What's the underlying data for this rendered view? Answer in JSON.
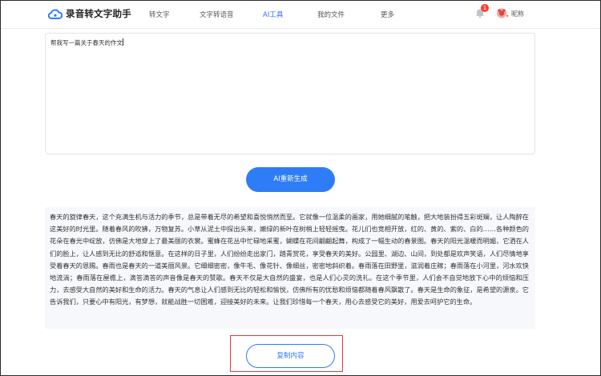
{
  "header": {
    "app_name": "录音转文字助手",
    "nav": [
      "转文字",
      "文字转语音",
      "AI工具",
      "我的文件",
      "更多"
    ],
    "active_nav": "AI工具",
    "notification_count": "1",
    "username": "昵称"
  },
  "prompt": {
    "text": "帮我写一篇关于春天的作文"
  },
  "regenerate_label": "AI重新生成",
  "result": {
    "text": "春天的旋律春天，这个充满生机与活力的季节，总是带着无尽的希望和喜悦悄然而至。它就像一位温柔的画家，用她细腻的笔触，把大地装扮得五彩斑斓，让人陶醉在这美好的时光里。随着春风的吹拂，万物复苏。小草从泥土中探出头来，嫩绿的新叶在树梢上轻轻摇曳。花儿们也竞相开放，红的、黄的、紫的、白的……各种颜色的花朵在春光中绽放，仿佛是大地穿上了最美丽的衣裳。蜜蜂在花丛中忙碌地采蜜，蝴蝶在花间翩翩起舞，构成了一幅生动的春景图。春天的阳光温暖而明媚，它洒在人们的脸上，让人感到无比的舒适和惬意。在这样的日子里，人们纷纷走出家门，踏青赏花，享受春天的美好。公园里、湖边、山间，到处都是欢声笑语，人们尽情地享受着春天的恩赐。春雨也是春天的一道美丽风景。它细细密密，像牛毛、像花针、像细丝，密密地斜织着。春雨落在田野里，滋润着庄稼；春雨落在小河里，河水欢快地流淌；春雨落在屋檐上，滴答滴答的声音像是春天的赞歌。春天不仅是大自然的盛宴，也是人们心灵的洗礼。在这个季节里，人们会不自觉地放下心中的烦恼和压力，去感受大自然的美好和生命的活力。春天的气息让人们感到无比的轻松和愉悦，仿佛所有的忧愁和烦恼都随着春风飘散了。春天是生命的象征，是希望的源泉。它告诉我们，只要心中有阳光，有梦想，就能战胜一切困难，迎接美好的未来。让我们珍惜每一个春天，用心去感受它的美好，用爱去呵护它的生命。"
  },
  "copy_label": "复制内容",
  "colors": {
    "accent": "#2f7df6",
    "highlight_outline": "#e23a3a",
    "result_bg": "#f6f8fb"
  }
}
